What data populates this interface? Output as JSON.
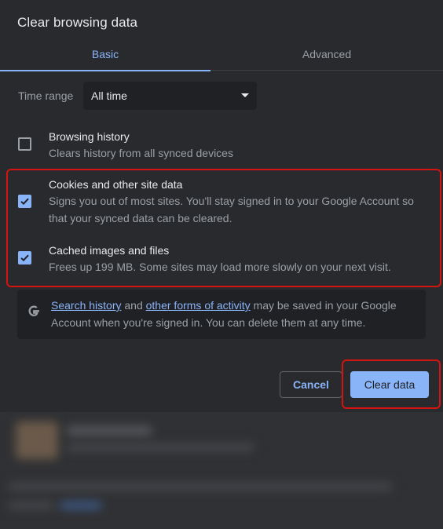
{
  "dialog": {
    "title": "Clear browsing data"
  },
  "tabs": [
    {
      "label": "Basic",
      "active": true
    },
    {
      "label": "Advanced",
      "active": false
    }
  ],
  "time_range": {
    "label": "Time range",
    "value": "All time"
  },
  "options": [
    {
      "title": "Browsing history",
      "description": "Clears history from all synced devices",
      "checked": false
    },
    {
      "title": "Cookies and other site data",
      "description": "Signs you out of most sites. You'll stay signed in to your Google Account so that your synced data can be cleared.",
      "checked": true
    },
    {
      "title": "Cached images and files",
      "description": "Frees up 199 MB. Some sites may load more slowly on your next visit.",
      "checked": true
    }
  ],
  "google_notice": {
    "link1": "Search history",
    "text1": " and ",
    "link2": "other forms of activity",
    "text2": " may be saved in your Google Account when you're signed in. You can delete them at any time."
  },
  "buttons": {
    "cancel": "Cancel",
    "clear": "Clear data"
  },
  "colors": {
    "accent": "#8ab4f8",
    "highlight": "#d3140f",
    "background": "#292a2d"
  }
}
